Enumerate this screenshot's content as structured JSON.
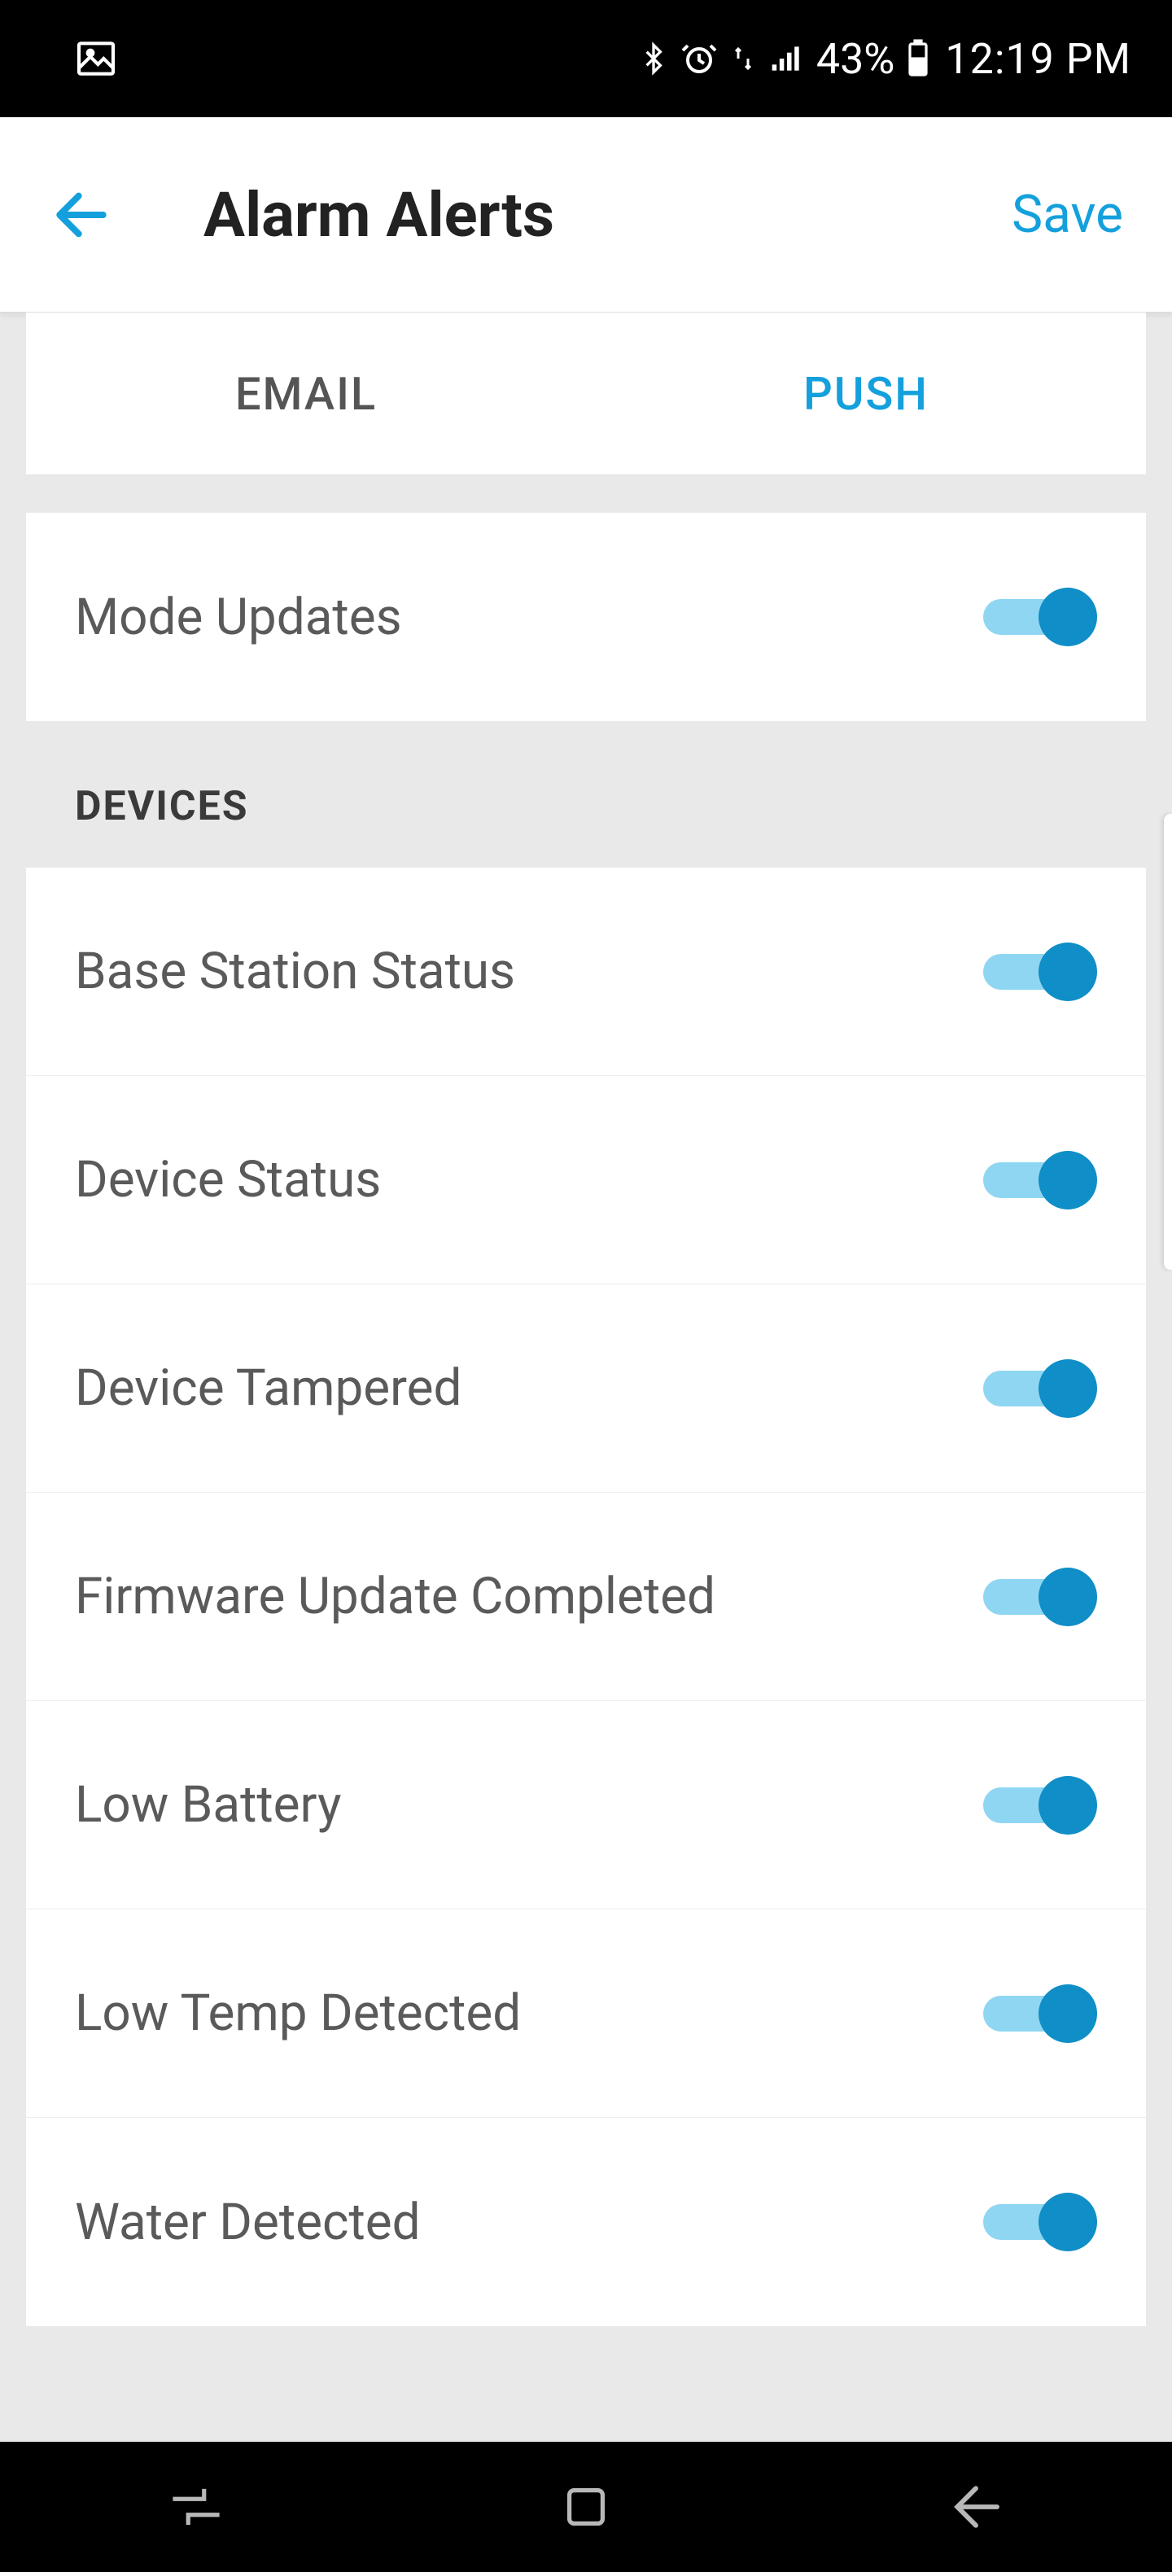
{
  "status": {
    "battery_pct": "43%",
    "time": "12:19 PM"
  },
  "header": {
    "title": "Alarm Alerts",
    "save_label": "Save"
  },
  "tabs": {
    "email": "EMAIL",
    "push": "PUSH",
    "active": "push"
  },
  "sections": {
    "top": [
      {
        "label": "Mode Updates",
        "on": true
      }
    ],
    "devices_header": "DEVICES",
    "devices": [
      {
        "label": "Base Station Status",
        "on": true
      },
      {
        "label": "Device Status",
        "on": true
      },
      {
        "label": "Device Tampered",
        "on": true
      },
      {
        "label": "Firmware Update Completed",
        "on": true
      },
      {
        "label": "Low Battery",
        "on": true
      },
      {
        "label": "Low Temp Detected",
        "on": true
      },
      {
        "label": "Water Detected",
        "on": true
      }
    ]
  },
  "colors": {
    "accent": "#14a0dc",
    "toggle_thumb": "#0f8ec7",
    "toggle_track": "#8fd6f2"
  }
}
